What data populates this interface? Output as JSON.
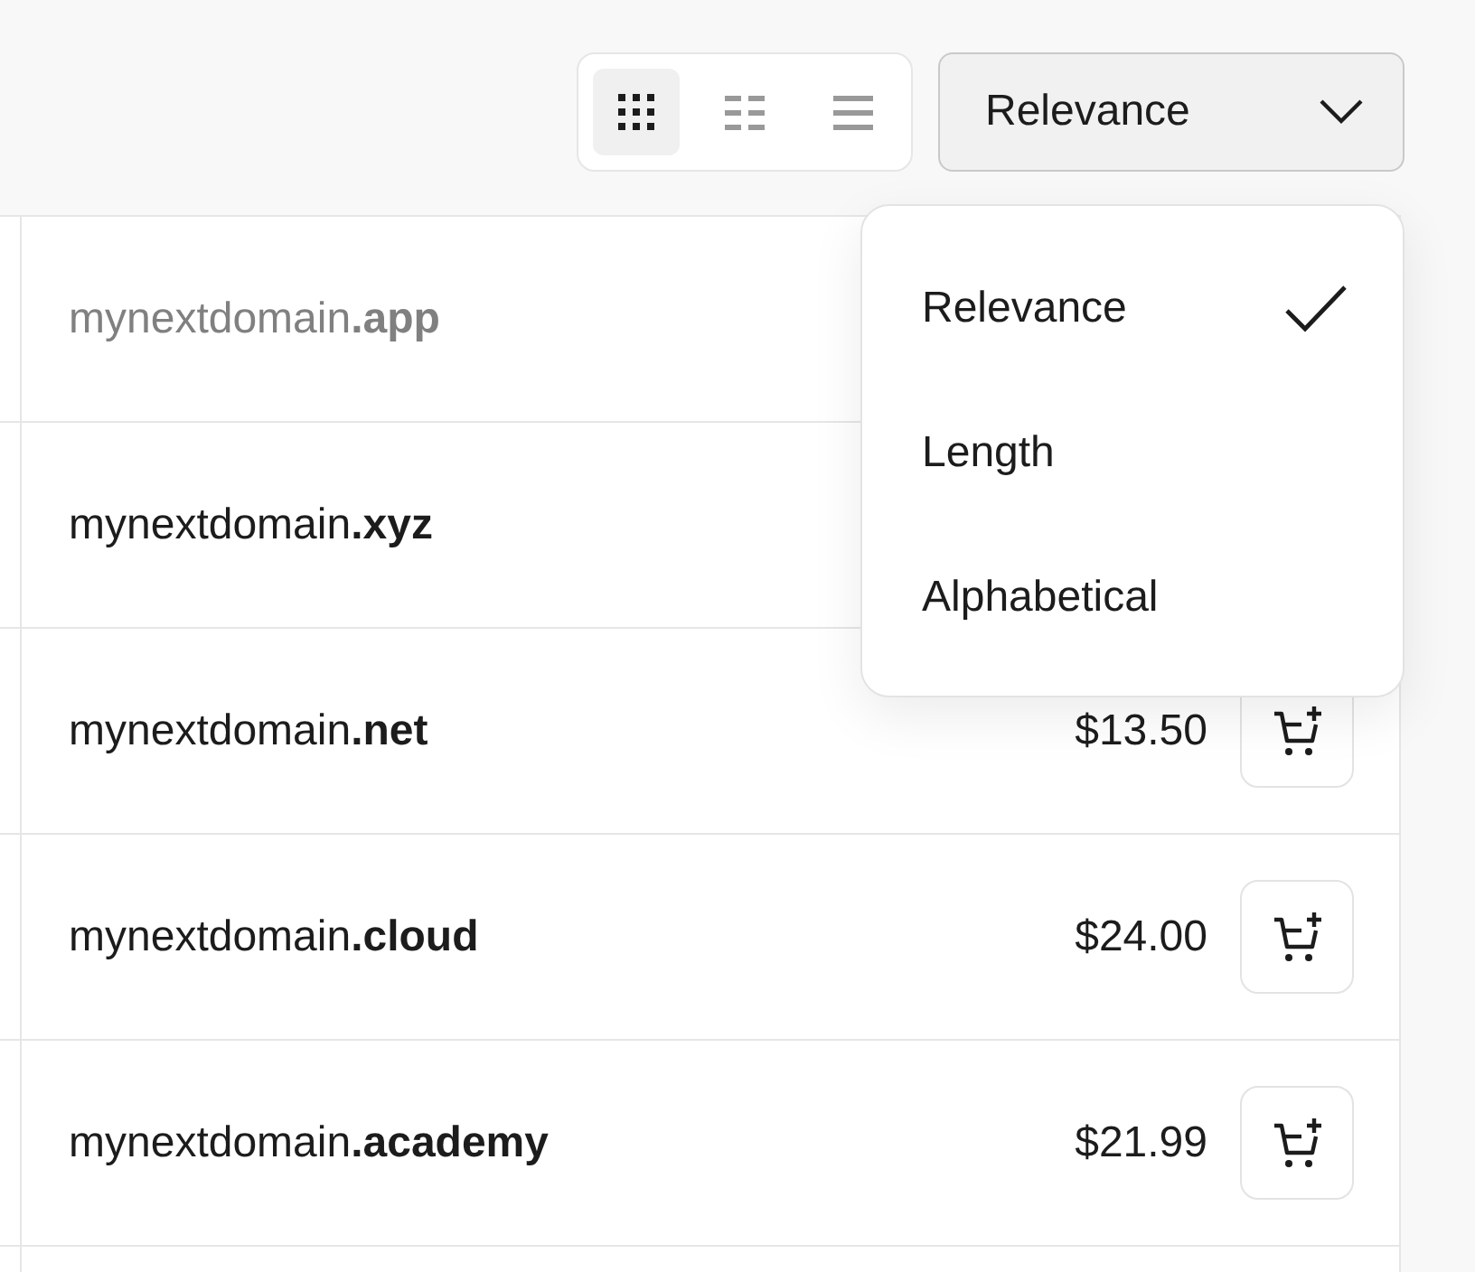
{
  "view_toggle": [
    {
      "kind": "grid",
      "selected": true
    },
    {
      "kind": "columns",
      "selected": false
    },
    {
      "kind": "list",
      "selected": false
    }
  ],
  "sort_select": {
    "value": "Relevance",
    "expanded": true
  },
  "sort_menu": [
    {
      "label": "Relevance",
      "selected": true
    },
    {
      "label": "Length",
      "selected": false
    },
    {
      "label": "Alphabetical",
      "selected": false
    }
  ],
  "domains": [
    {
      "name": "mynextdomain**.app**",
      "disabled": true
    },
    {
      "name": "mynextdomain**.xyz**",
      "disabled": false
    },
    {
      "name": "mynextdomain**.net**",
      "disabled": false,
      "price": "$13.50"
    },
    {
      "name": "mynextdomain**.cloud**",
      "disabled": false,
      "price": "$24.00"
    },
    {
      "name": "mynextdomain**.academy**",
      "disabled": false,
      "price": "$21.99"
    }
  ]
}
